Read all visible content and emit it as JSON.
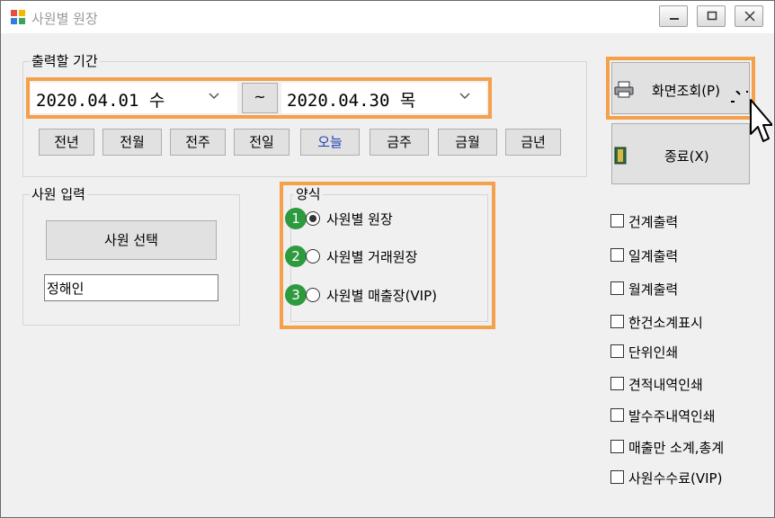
{
  "window": {
    "title": "사원별 원장"
  },
  "period": {
    "label": "출력할 기간",
    "start_date": "2020.04.01 수",
    "separator": "~",
    "end_date": "2020.04.30 목",
    "quick_buttons": [
      "전년",
      "전월",
      "전주",
      "전일",
      "오늘",
      "금주",
      "금월",
      "금년"
    ],
    "today_color": "#1a3fb5"
  },
  "employee": {
    "label": "사원 입력",
    "select_button": "사원 선택",
    "name_value": "정해인"
  },
  "format": {
    "label": "양식",
    "selected_index": 0,
    "options": [
      {
        "num": "1",
        "label": "사원별 원장"
      },
      {
        "num": "2",
        "label": "사원별 거래원장"
      },
      {
        "num": "3",
        "label": "사원별 매출장(VIP)"
      }
    ]
  },
  "actions": {
    "view_label": "화면조회(P)",
    "exit_label": "종료(X)"
  },
  "options": [
    "건계출력",
    "일계출력",
    "월계출력",
    "한건소계표시",
    "단위인쇄",
    "견적내역인쇄",
    "발수주내역인쇄",
    "매출만 소계,총계",
    "사원수수료(VIP)"
  ],
  "colors": {
    "highlight": "#f5a04a",
    "step_number": "#2e9a3e"
  }
}
